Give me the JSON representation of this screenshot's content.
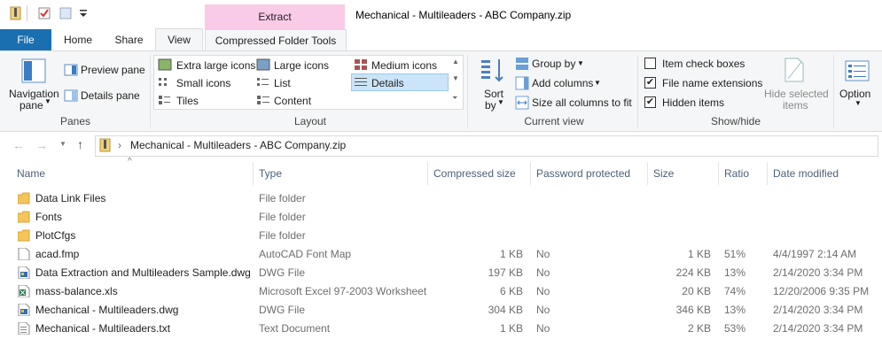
{
  "window": {
    "title": "Mechanical - Multileaders - ABC Company.zip",
    "context_tab_group": "Extract"
  },
  "tabs": {
    "file": "File",
    "home": "Home",
    "share": "Share",
    "view": "View",
    "compressed": "Compressed Folder Tools"
  },
  "ribbon": {
    "panes": {
      "navigation_pane_line1": "Navigation",
      "navigation_pane_line2": "pane",
      "preview_pane": "Preview pane",
      "details_pane": "Details pane",
      "label": "Panes"
    },
    "layout": {
      "extra_large_icons": "Extra large icons",
      "large_icons": "Large icons",
      "medium_icons": "Medium icons",
      "small_icons": "Small icons",
      "list": "List",
      "details": "Details",
      "tiles": "Tiles",
      "content": "Content",
      "label": "Layout",
      "selected": "Details"
    },
    "current_view": {
      "sort_line1": "Sort",
      "sort_line2": "by",
      "group_by": "Group by",
      "add_columns": "Add columns",
      "size_all_columns": "Size all columns to fit",
      "label": "Current view"
    },
    "show_hide": {
      "item_check_boxes": "Item check boxes",
      "item_check_boxes_checked": false,
      "file_name_extensions": "File name extensions",
      "file_name_extensions_checked": true,
      "hidden_items": "Hidden items",
      "hidden_items_checked": true,
      "hide_selected_line1": "Hide selected",
      "hide_selected_line2": "items",
      "label": "Show/hide"
    },
    "options": "Option"
  },
  "address": {
    "path": "Mechanical - Multileaders - ABC Company.zip"
  },
  "columns": {
    "name": "Name",
    "type": "Type",
    "compressed_size": "Compressed size",
    "password_protected": "Password protected",
    "size": "Size",
    "ratio": "Ratio",
    "date_modified": "Date modified"
  },
  "files": [
    {
      "name": "Data Link Files",
      "type": "File folder",
      "compressed_size": "",
      "password": "",
      "size": "",
      "ratio": "",
      "date": "",
      "icon": "folder-icon"
    },
    {
      "name": "Fonts",
      "type": "File folder",
      "compressed_size": "",
      "password": "",
      "size": "",
      "ratio": "",
      "date": "",
      "icon": "folder-icon"
    },
    {
      "name": "PlotCfgs",
      "type": "File folder",
      "compressed_size": "",
      "password": "",
      "size": "",
      "ratio": "",
      "date": "",
      "icon": "folder-icon"
    },
    {
      "name": "acad.fmp",
      "type": "AutoCAD Font Map",
      "compressed_size": "1 KB",
      "password": "No",
      "size": "1 KB",
      "ratio": "51%",
      "date": "4/4/1997 2:14 AM",
      "icon": "document-icon"
    },
    {
      "name": "Data Extraction and Multileaders Sample.dwg",
      "type": "DWG File",
      "compressed_size": "197 KB",
      "password": "No",
      "size": "224 KB",
      "ratio": "13%",
      "date": "2/14/2020 3:34 PM",
      "icon": "dwg-file-icon"
    },
    {
      "name": "mass-balance.xls",
      "type": "Microsoft Excel 97-2003 Worksheet",
      "compressed_size": "6 KB",
      "password": "No",
      "size": "20 KB",
      "ratio": "74%",
      "date": "12/20/2006 9:35 PM",
      "icon": "excel-file-icon"
    },
    {
      "name": "Mechanical - Multileaders.dwg",
      "type": "DWG File",
      "compressed_size": "304 KB",
      "password": "No",
      "size": "346 KB",
      "ratio": "13%",
      "date": "2/14/2020 3:34 PM",
      "icon": "dwg-file-icon"
    },
    {
      "name": "Mechanical - Multileaders.txt",
      "type": "Text Document",
      "compressed_size": "1 KB",
      "password": "No",
      "size": "2 KB",
      "ratio": "53%",
      "date": "2/14/2020 3:34 PM",
      "icon": "text-file-icon"
    }
  ]
}
